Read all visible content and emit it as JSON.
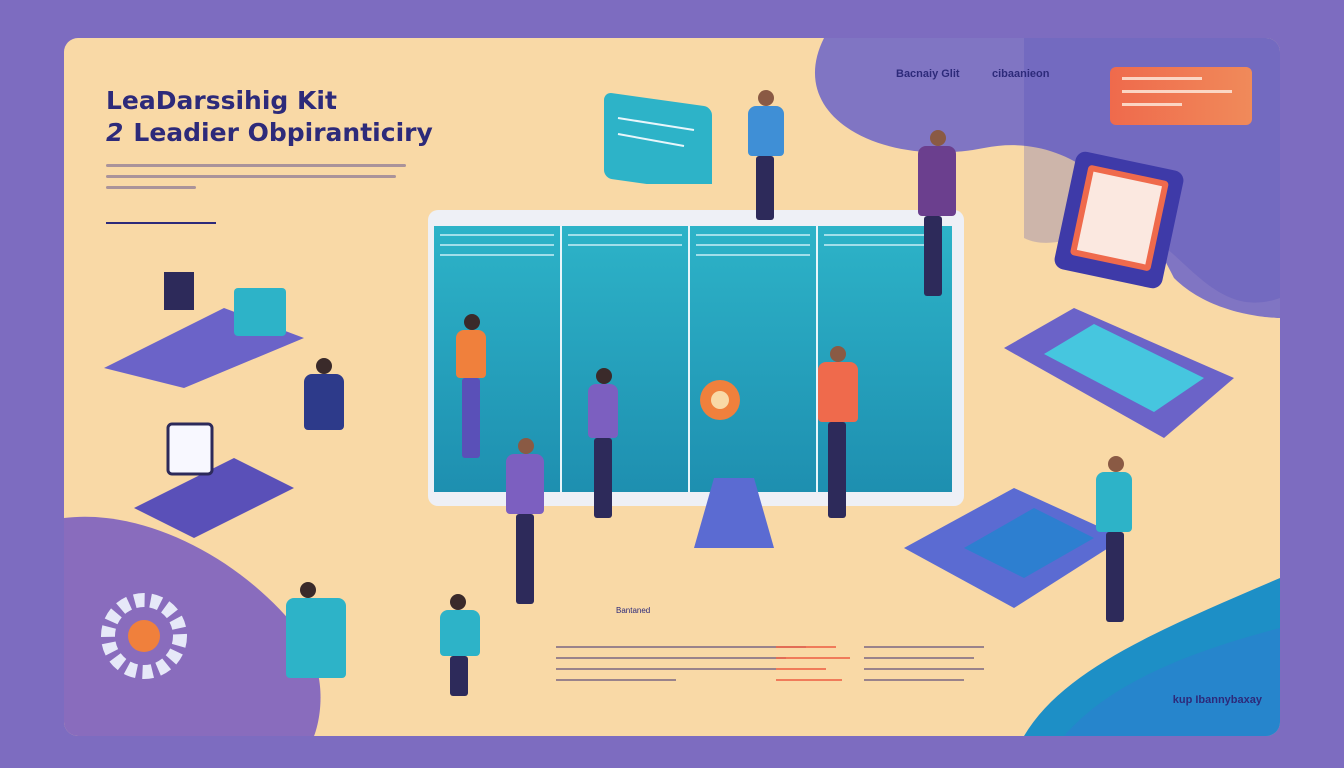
{
  "title": "LeaDarssihig Kit",
  "subtitle_number": "2",
  "subtitle_text": "Leadier Obpiranticiry",
  "header_links": [
    "Bacnaiy Glit",
    "cibaanieon"
  ],
  "corner_text": "kup Ibannybaxay",
  "small_tag": "Bantaned",
  "colors": {
    "background": "#7d6cc0",
    "card": "#f9d9a6",
    "title": "#2d2a7a",
    "accent_orange": "#ef6a4c",
    "teal": "#2db3c8"
  }
}
